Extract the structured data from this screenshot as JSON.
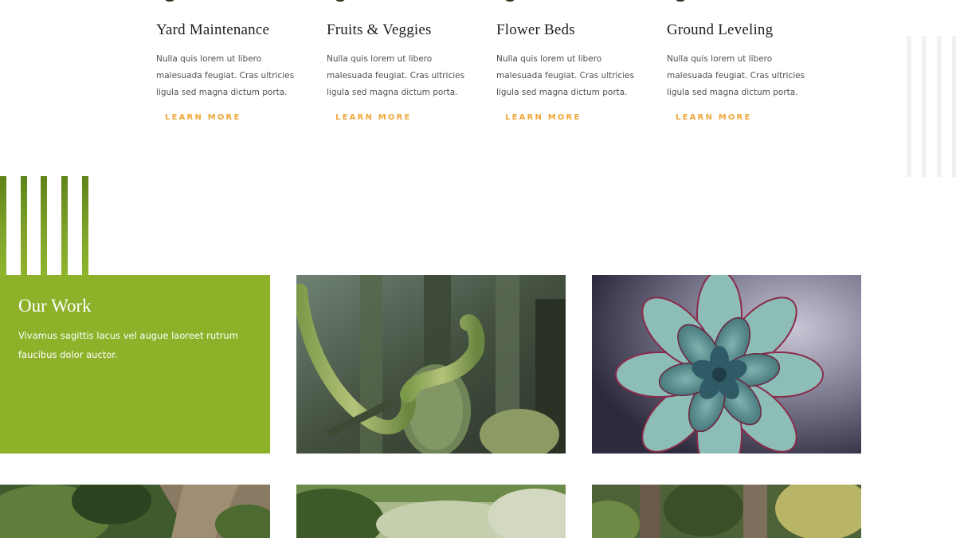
{
  "services": [
    {
      "title": "Yard Maintenance",
      "description": "Nulla quis lorem ut libero malesuada feugiat. Cras ultricies ligula sed magna dictum porta.",
      "cta": "LEARN MORE"
    },
    {
      "title": "Fruits & Veggies",
      "description": "Nulla quis lorem ut libero malesuada feugiat. Cras ultricies ligula sed magna dictum porta.",
      "cta": "LEARN MORE"
    },
    {
      "title": "Flower Beds",
      "description": "Nulla quis lorem ut libero malesuada feugiat. Cras ultricies ligula sed magna dictum porta.",
      "cta": "LEARN MORE"
    },
    {
      "title": "Ground Leveling",
      "description": "Nulla quis lorem ut libero malesuada feugiat. Cras ultricies ligula sed magna dictum porta.",
      "cta": "LEARN MORE"
    }
  ],
  "work": {
    "title": "Our Work",
    "description": "Vivamus sagittis lacus vel augue laoreet rutrum faucibus dolor auctor."
  },
  "gallery": [
    {
      "icon": "cactus-photo"
    },
    {
      "icon": "succulent-photo"
    },
    {
      "icon": "garden-path-photo"
    },
    {
      "icon": "shrub-garden-photo"
    },
    {
      "icon": "forest-plants-photo"
    }
  ],
  "colors": {
    "accent_orange": "#f0a73b",
    "brand_green": "#8db22a",
    "heading_dark": "#1f1f1f",
    "body_text": "#4f4f4f"
  }
}
